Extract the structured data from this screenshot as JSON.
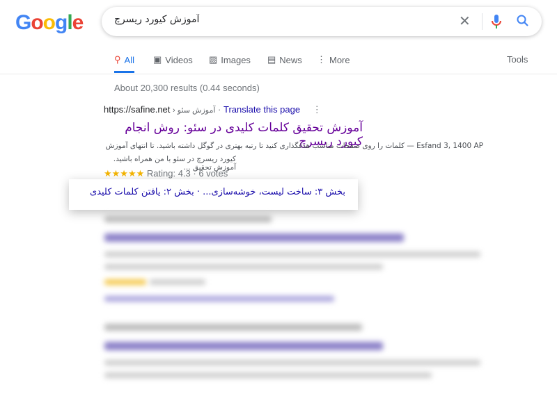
{
  "logo": "Google",
  "search": {
    "query": "آموزش کیورد ریسرچ",
    "clear_icon": "close-icon",
    "mic_icon": "mic-icon",
    "search_icon": "search-icon"
  },
  "tabs": [
    {
      "label": "All",
      "icon": "search-icon",
      "active": true
    },
    {
      "label": "Videos",
      "icon": "play-icon"
    },
    {
      "label": "Images",
      "icon": "image-icon"
    },
    {
      "label": "News",
      "icon": "news-icon"
    },
    {
      "label": "More",
      "icon": "more-vert-icon"
    }
  ],
  "tools_label": "Tools",
  "result_stats": "About 20,300 results (0.44 seconds)",
  "result": {
    "url": "https://safine.net",
    "breadcrumb": "› آموزش سئو",
    "separator": "·",
    "translate": "Translate this page",
    "title": "آموزش تحقیق کلمات کلیدی در سئو: روش انجام کیورد ریسرچ",
    "snippet_line1": "Esfand 3, 1400 AP — کلمات را روی صفحات مناسب هدفگذاری کنید تا رتبه بهتری در گوگل داشته باشید. تا انتهای آموزش",
    "snippet_line2": "کیورد ریسرچ در سئو با من همراه باشید. آموزش تحقیق ...",
    "stars": "★★★★★",
    "rating": "Rating: 4.3 · 6 votes",
    "rating_value": 4.3
  },
  "sitelinks": "بخش ۳: ساخت لیست، خوشه‌سازی... · بخش ۲: یافتن کلمات کلیدی",
  "colors": {
    "link": "#1a0dab",
    "visited": "#660099",
    "accent": "#1a73e8",
    "star": "#f4b400"
  }
}
